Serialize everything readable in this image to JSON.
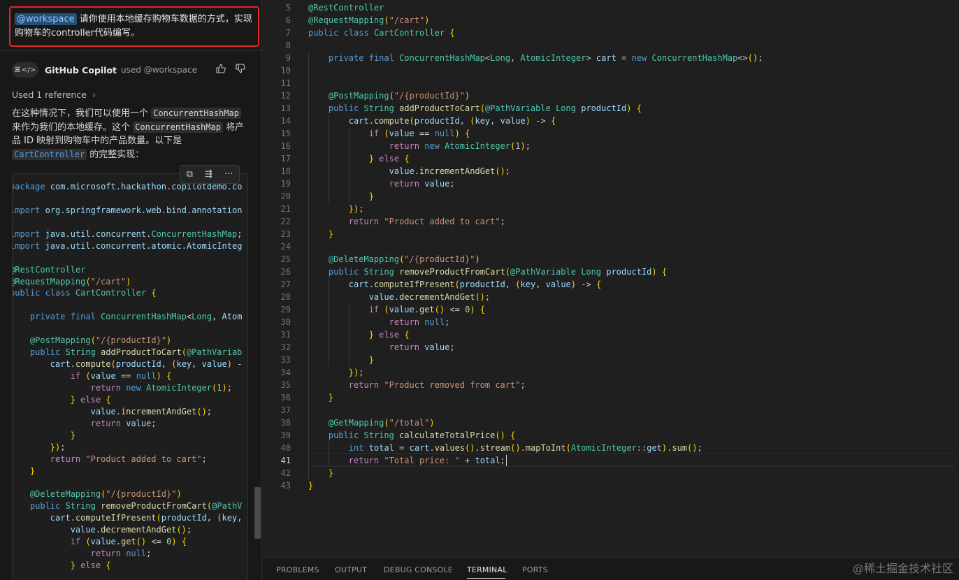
{
  "chat": {
    "user_message": {
      "mention": "@workspace",
      "text": " 请你使用本地缓存购物车数据的方式，实现购物车的controller代码编写。"
    },
    "assistant": {
      "name": "GitHub Copilot",
      "used": "used @workspace",
      "avatar_left_glyph": "ꕤ",
      "avatar_right_glyph": "</>"
    },
    "reference_label": "Used 1 reference",
    "answer": {
      "p1_a": "在这种情况下，我们可以使用一个 ",
      "code1": "ConcurrentHashMap",
      "p1_b": "来作为我们的本地缓存。这个 ",
      "code2": "ConcurrentHashMap",
      "p1_c": " 将产品 ID 映射到购物车中的产品数量。以下是 ",
      "code3": "CartController",
      "p1_d": " 的完整实现："
    },
    "code_lines": [
      "package com.microsoft.hackathon.copilotdemo.co",
      "",
      "import org.springframework.web.bind.annotation",
      "",
      "import java.util.concurrent.ConcurrentHashMap;",
      "import java.util.concurrent.atomic.AtomicInteg",
      "",
      "@RestController",
      "@RequestMapping(\"/cart\")",
      "public class CartController {",
      "",
      "    private final ConcurrentHashMap<Long, Atom",
      "",
      "    @PostMapping(\"/{productId}\")",
      "    public String addProductToCart(@PathVariab",
      "        cart.compute(productId, (key, value) -",
      "            if (value == null) {",
      "                return new AtomicInteger(1);",
      "            } else {",
      "                value.incrementAndGet();",
      "                return value;",
      "            }",
      "        });",
      "        return \"Product added to cart\";",
      "    }",
      "",
      "    @DeleteMapping(\"/{productId}\")",
      "    public String removeProductFromCart(@PathV",
      "        cart.computeIfPresent(productId, (key,",
      "            value.decrementAndGet();",
      "            if (value.get() <= 0) {",
      "                return null;",
      "            } else {"
    ]
  },
  "editor": {
    "line_numbers": [
      "5",
      "6",
      "7",
      "8",
      "9",
      "10",
      "11",
      "12",
      "13",
      "14",
      "15",
      "16",
      "17",
      "18",
      "19",
      "20",
      "21",
      "22",
      "23",
      "24",
      "25",
      "26",
      "27",
      "28",
      "29",
      "30",
      "31",
      "32",
      "33",
      "34",
      "35",
      "36",
      "37",
      "38",
      "39",
      "40",
      "41",
      "42",
      "43"
    ],
    "active_line": "41",
    "code_lines": [
      "@RestController",
      "@RequestMapping(\"/cart\")",
      "public class CartController {",
      "",
      "    private final ConcurrentHashMap<Long, AtomicInteger> cart = new ConcurrentHashMap<>();",
      "",
      "",
      "    @PostMapping(\"/{productId}\")",
      "    public String addProductToCart(@PathVariable Long productId) {",
      "        cart.compute(productId, (key, value) -> {",
      "            if (value == null) {",
      "                return new AtomicInteger(1);",
      "            } else {",
      "                value.incrementAndGet();",
      "                return value;",
      "            }",
      "        });",
      "        return \"Product added to cart\";",
      "    }",
      "",
      "    @DeleteMapping(\"/{productId}\")",
      "    public String removeProductFromCart(@PathVariable Long productId) {",
      "        cart.computeIfPresent(productId, (key, value) -> {",
      "            value.decrementAndGet();",
      "            if (value.get() <= 0) {",
      "                return null;",
      "            } else {",
      "                return value;",
      "            }",
      "        });",
      "        return \"Product removed from cart\";",
      "    }",
      "",
      "    @GetMapping(\"/total\")",
      "    public String calculateTotalPrice() {",
      "        int total = cart.values().stream().mapToInt(AtomicInteger::get).sum();",
      "        return \"Total price: \" + total;",
      "    }",
      "}"
    ]
  },
  "panel": {
    "tabs": [
      "PROBLEMS",
      "OUTPUT",
      "DEBUG CONSOLE",
      "TERMINAL",
      "PORTS"
    ],
    "active_tab": "TERMINAL"
  },
  "watermark": "@稀土掘金技术社区"
}
